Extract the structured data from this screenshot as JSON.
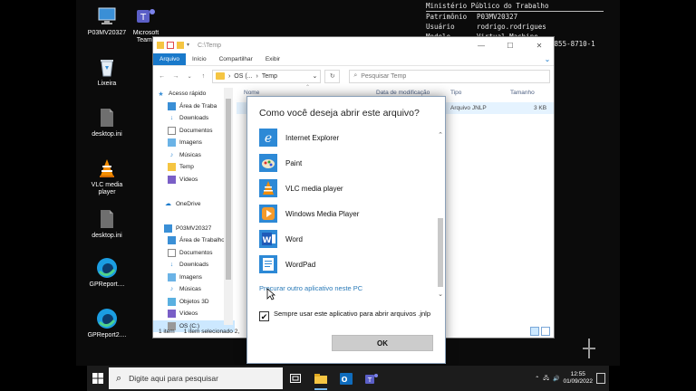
{
  "desktop": {
    "icons": [
      {
        "label": "P03MV20327",
        "icon": "computer-icon"
      },
      {
        "label": "Microsoft Teams",
        "icon": "teams-icon"
      },
      {
        "label": "Lixeira",
        "icon": "recycle-bin-icon"
      },
      {
        "label": "desktop.ini",
        "icon": "ini-file-icon"
      },
      {
        "label": "VLC media player",
        "icon": "vlc-icon"
      },
      {
        "label": "desktop.ini",
        "icon": "ini-file-icon"
      },
      {
        "label": "GPReport....",
        "icon": "edge-icon"
      },
      {
        "label": "GPReport2....",
        "icon": "edge-icon"
      }
    ]
  },
  "bginfo": {
    "header": "Ministério Público do Trabalho",
    "rows": [
      {
        "key": "Patrimônio",
        "value": "P03MV20327"
      },
      {
        "key": "Usuário",
        "value": "rodrigo.rodrigues"
      },
      {
        "key": "Modelo",
        "value": "Virtual Machine"
      }
    ],
    "guid_fragment": "5-5855-8710-1"
  },
  "explorer": {
    "title_path": "C:\\Temp",
    "ribbon_tabs": [
      "Arquivo",
      "Início",
      "Compartilhar",
      "Exibir"
    ],
    "address_parts": [
      "OS (...",
      "Temp"
    ],
    "search_placeholder": "Pesquisar Temp",
    "nav_items": [
      {
        "label": "Acesso rápido",
        "icon": "star-icon",
        "pinned": false,
        "selected": false
      },
      {
        "label": "Área de Traba",
        "icon": "desktop-folder-icon",
        "pinned": true,
        "selected": false
      },
      {
        "label": "Downloads",
        "icon": "download-icon",
        "pinned": true,
        "selected": false
      },
      {
        "label": "Documentos",
        "icon": "documents-icon",
        "pinned": true,
        "selected": false
      },
      {
        "label": "Imagens",
        "icon": "pictures-icon",
        "pinned": true,
        "selected": false
      },
      {
        "label": "Músicas",
        "icon": "music-icon",
        "pinned": false,
        "selected": false
      },
      {
        "label": "Temp",
        "icon": "folder-icon",
        "pinned": false,
        "selected": false
      },
      {
        "label": "Vídeos",
        "icon": "videos-icon",
        "pinned": false,
        "selected": false
      },
      {
        "label": "",
        "icon": "",
        "pinned": false,
        "selected": false
      },
      {
        "label": "OneDrive",
        "icon": "onedrive-icon",
        "pinned": false,
        "selected": false
      },
      {
        "label": "",
        "icon": "",
        "pinned": false,
        "selected": false
      },
      {
        "label": "P03MV20327",
        "icon": "computer-icon",
        "pinned": false,
        "selected": false
      },
      {
        "label": "Área de Trabalho",
        "icon": "desktop-folder-icon",
        "pinned": false,
        "selected": false
      },
      {
        "label": "Documentos",
        "icon": "documents-icon",
        "pinned": false,
        "selected": false
      },
      {
        "label": "Downloads",
        "icon": "download-icon",
        "pinned": false,
        "selected": false
      },
      {
        "label": "Imagens",
        "icon": "pictures-icon",
        "pinned": false,
        "selected": false
      },
      {
        "label": "Músicas",
        "icon": "music-icon",
        "pinned": false,
        "selected": false
      },
      {
        "label": "Objetos 3D",
        "icon": "objects3d-icon",
        "pinned": false,
        "selected": false
      },
      {
        "label": "Vídeos",
        "icon": "videos-icon",
        "pinned": false,
        "selected": false
      },
      {
        "label": "OS (C:)",
        "icon": "drive-icon",
        "pinned": false,
        "selected": true
      }
    ],
    "columns": [
      "Nome",
      "Data de modificação",
      "Tipo",
      "Tamanho"
    ],
    "file": {
      "type": "Arquivo JNLP",
      "size": "3 KB"
    },
    "status_items": "1 item",
    "status_selected": "1 item selecionado  2,"
  },
  "dialog": {
    "title": "Como você deseja abrir este arquivo?",
    "apps": [
      {
        "name": "Internet Explorer",
        "icon": "internet-explorer-icon"
      },
      {
        "name": "Paint",
        "icon": "paint-icon"
      },
      {
        "name": "VLC media player",
        "icon": "vlc-icon"
      },
      {
        "name": "Windows Media Player",
        "icon": "windows-media-player-icon"
      },
      {
        "name": "Word",
        "icon": "word-icon"
      },
      {
        "name": "WordPad",
        "icon": "wordpad-icon"
      }
    ],
    "more_apps_link": "Procurar outro aplicativo neste PC",
    "always_use_label": "Sempre usar este aplicativo para abrir arquivos .jnlp",
    "always_use_checked": true,
    "ok_label": "OK"
  },
  "taskbar": {
    "search_placeholder": "Digite aqui para pesquisar",
    "time": "12:55",
    "date": "01/09/2022"
  },
  "colors": {
    "accent": "#1979ca",
    "link": "#2a7ab8",
    "selection": "#cce8ff"
  }
}
